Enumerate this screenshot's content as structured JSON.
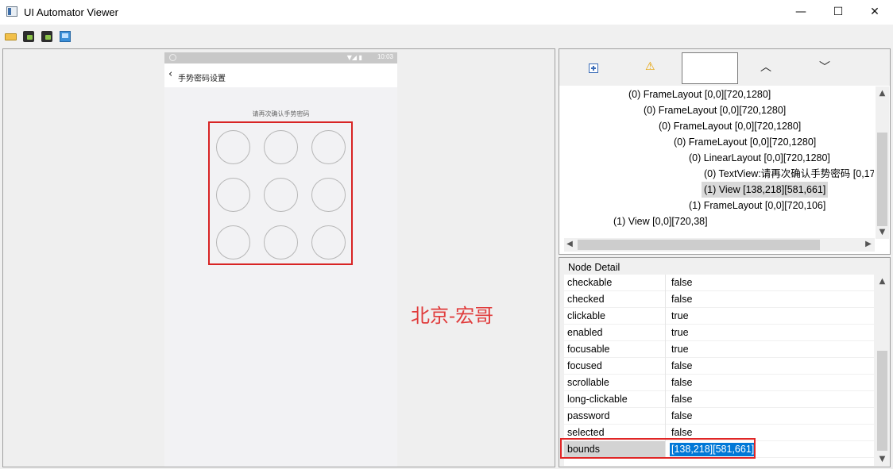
{
  "window": {
    "title": "UI Automator Viewer",
    "minimize_glyph": "—",
    "maximize_glyph": "☐",
    "close_glyph": "✕"
  },
  "toolbar": {
    "items": [
      "open-icon",
      "device-screenshot-icon",
      "device-screenshot-compressed-icon",
      "save-icon"
    ]
  },
  "phone": {
    "status_time": "10:03",
    "status_icons": "▼◢ ▮",
    "back_glyph": "‹",
    "page_title": "手势密码设置",
    "prompt": "请再次确认手势密码",
    "dots": 9
  },
  "watermark": "北京-宏哥",
  "hierarchy": {
    "nav_up_glyph": "︿",
    "nav_down_glyph": "﹀",
    "warn_glyph": "⚠",
    "nodes": [
      {
        "label": "(0) FrameLayout [0,0][720,1280]",
        "depth": 0,
        "selected": false
      },
      {
        "label": "(0) FrameLayout [0,0][720,1280]",
        "depth": 1,
        "selected": false
      },
      {
        "label": "(0) FrameLayout [0,0][720,1280]",
        "depth": 2,
        "selected": false
      },
      {
        "label": "(0) FrameLayout [0,0][720,1280]",
        "depth": 3,
        "selected": false
      },
      {
        "label": "(0) LinearLayout [0,0][720,1280]",
        "depth": 4,
        "selected": false
      },
      {
        "label": "(0) TextView:请再次确认手势密码 [0,17",
        "depth": 5,
        "selected": false
      },
      {
        "label": "(1) View [138,218][581,661]",
        "depth": 5,
        "selected": true
      },
      {
        "label": "(1) FrameLayout [0,0][720,106]",
        "depth": 4,
        "selected": false
      },
      {
        "label": "(1) View [0,0][720,38]",
        "depth": -1,
        "selected": false
      }
    ]
  },
  "node_detail": {
    "title": "Node Detail",
    "rows": [
      {
        "key": "checkable",
        "value": "false"
      },
      {
        "key": "checked",
        "value": "false"
      },
      {
        "key": "clickable",
        "value": "true"
      },
      {
        "key": "enabled",
        "value": "true"
      },
      {
        "key": "focusable",
        "value": "true"
      },
      {
        "key": "focused",
        "value": "false"
      },
      {
        "key": "scrollable",
        "value": "false"
      },
      {
        "key": "long-clickable",
        "value": "false"
      },
      {
        "key": "password",
        "value": "false"
      },
      {
        "key": "selected",
        "value": "false"
      }
    ],
    "bounds_key": "bounds",
    "bounds_value": "[138,218][581,661]"
  },
  "colors": {
    "highlight": "#d82424",
    "selection": "#0078d7",
    "watermark": "#e03b3b"
  }
}
